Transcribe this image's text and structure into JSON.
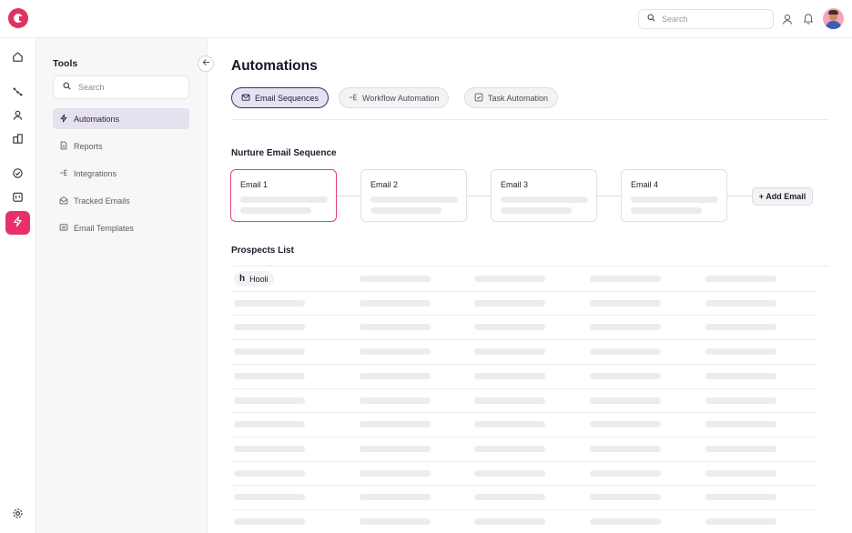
{
  "topbar": {
    "search_placeholder": "Search"
  },
  "tools": {
    "title": "Tools",
    "search_placeholder": "Search",
    "items": [
      {
        "label": "Automations",
        "icon": "lightning-icon"
      },
      {
        "label": "Reports",
        "icon": "document-icon"
      },
      {
        "label": "Integrations",
        "icon": "integrations-icon"
      },
      {
        "label": "Tracked Emails",
        "icon": "envelope-open-icon"
      },
      {
        "label": "Email Templates",
        "icon": "template-icon"
      }
    ]
  },
  "main": {
    "title": "Automations",
    "tabs": [
      {
        "label": "Email Sequences",
        "icon": "mail-icon"
      },
      {
        "label": "Workflow Automation",
        "icon": "workflow-icon"
      },
      {
        "label": "Task Automation",
        "icon": "checkbox-icon"
      }
    ],
    "sequence_title": "Nurture Email Sequence",
    "emails": [
      {
        "label": "Email 1"
      },
      {
        "label": "Email 2"
      },
      {
        "label": "Email 3"
      },
      {
        "label": "Email 4"
      }
    ],
    "add_email_label": "+ Add Email",
    "prospects_title": "Prospects List",
    "first_prospect": {
      "logo": "h",
      "name": "Hooli"
    }
  },
  "colors": {
    "brand": "#e0315f",
    "active_rail": "#e8316a",
    "active_tab_bg": "#e7e2f1",
    "active_tool_bg": "#e6e1ef"
  }
}
